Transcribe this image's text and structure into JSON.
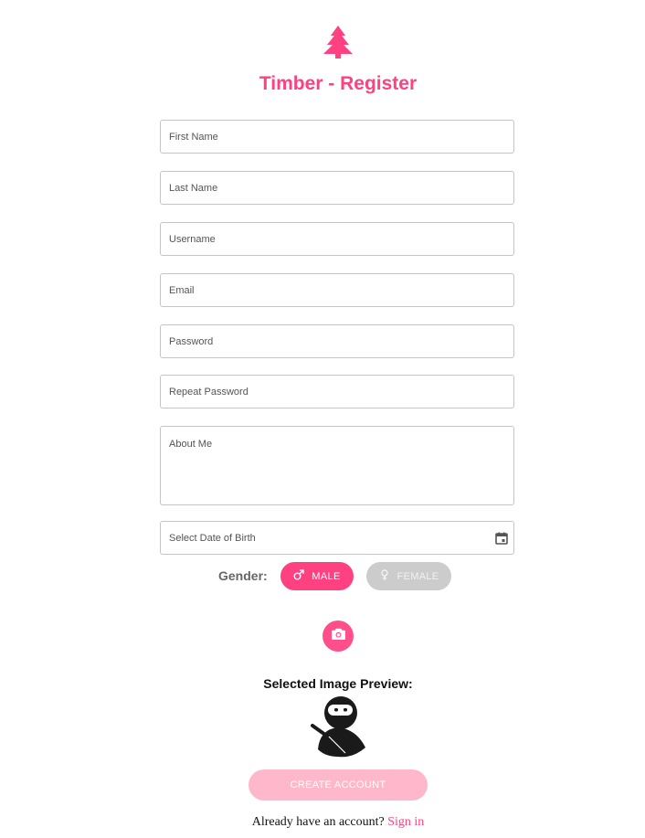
{
  "app": {
    "title": "Timber - Register",
    "accent_color": "#ff4081",
    "logo_icon": "tree-icon"
  },
  "form": {
    "first_name_placeholder": "First Name",
    "last_name_placeholder": "Last Name",
    "username_placeholder": "Username",
    "email_placeholder": "Email",
    "password_placeholder": "Password",
    "repeat_password_placeholder": "Repeat Password",
    "about_me_placeholder": "About Me",
    "dob_placeholder": "Select Date of Birth",
    "dob_icon": "calendar-icon"
  },
  "gender": {
    "label": "Gender:",
    "male_label": "MALE",
    "female_label": "FEMALE",
    "selected": "MALE"
  },
  "image": {
    "upload_icon": "camera-icon",
    "preview_label": "Selected Image Preview:",
    "preview_icon": "ninja-avatar"
  },
  "actions": {
    "create_account_label": "CREATE ACCOUNT"
  },
  "footer": {
    "prompt": "Already have an account?",
    "sign_in_label": "Sign in"
  }
}
